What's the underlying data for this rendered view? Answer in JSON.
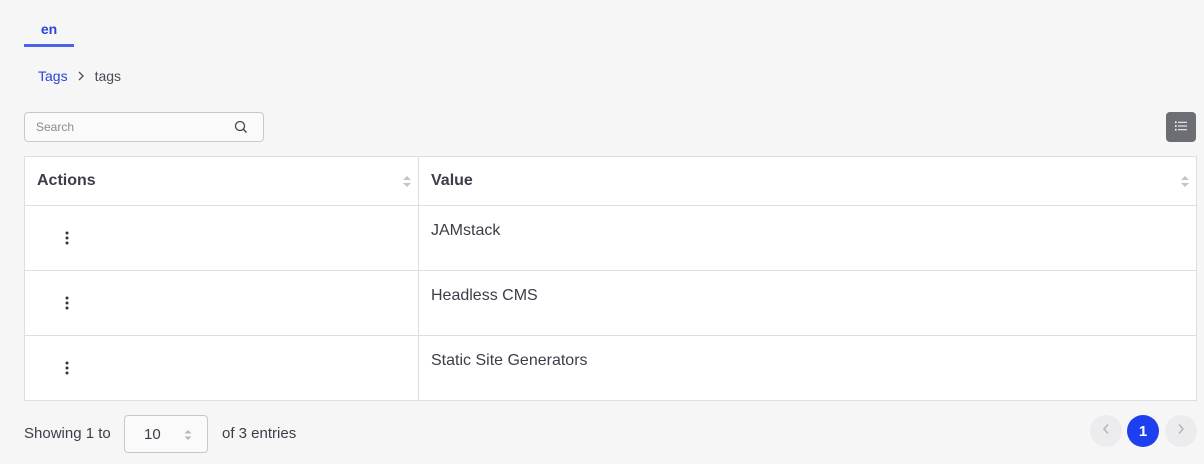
{
  "tabs": [
    {
      "label": "en"
    }
  ],
  "breadcrumb": {
    "parent": "Tags",
    "current": "tags"
  },
  "search": {
    "placeholder": "Search",
    "value": ""
  },
  "table": {
    "columns": [
      "Actions",
      "Value"
    ],
    "rows": [
      {
        "value": "JAMstack"
      },
      {
        "value": "Headless CMS"
      },
      {
        "value": "Static Site Generators"
      }
    ]
  },
  "footer": {
    "showing_prefix": "Showing 1 to",
    "page_size": "10",
    "showing_suffix": "of 3 entries"
  },
  "pagination": {
    "current_page": "1"
  },
  "icons": {
    "search": "search-icon",
    "list_view": "list-icon",
    "row_actions": "kebab-icon",
    "sort": "sort-icon",
    "breadcrumb_separator": "chevron-right-icon",
    "prev": "chevron-left-icon",
    "next": "chevron-right-icon"
  },
  "colors": {
    "accent": "#1e3ff0",
    "link": "#2a44d8",
    "list_button": "#6d6e73"
  }
}
